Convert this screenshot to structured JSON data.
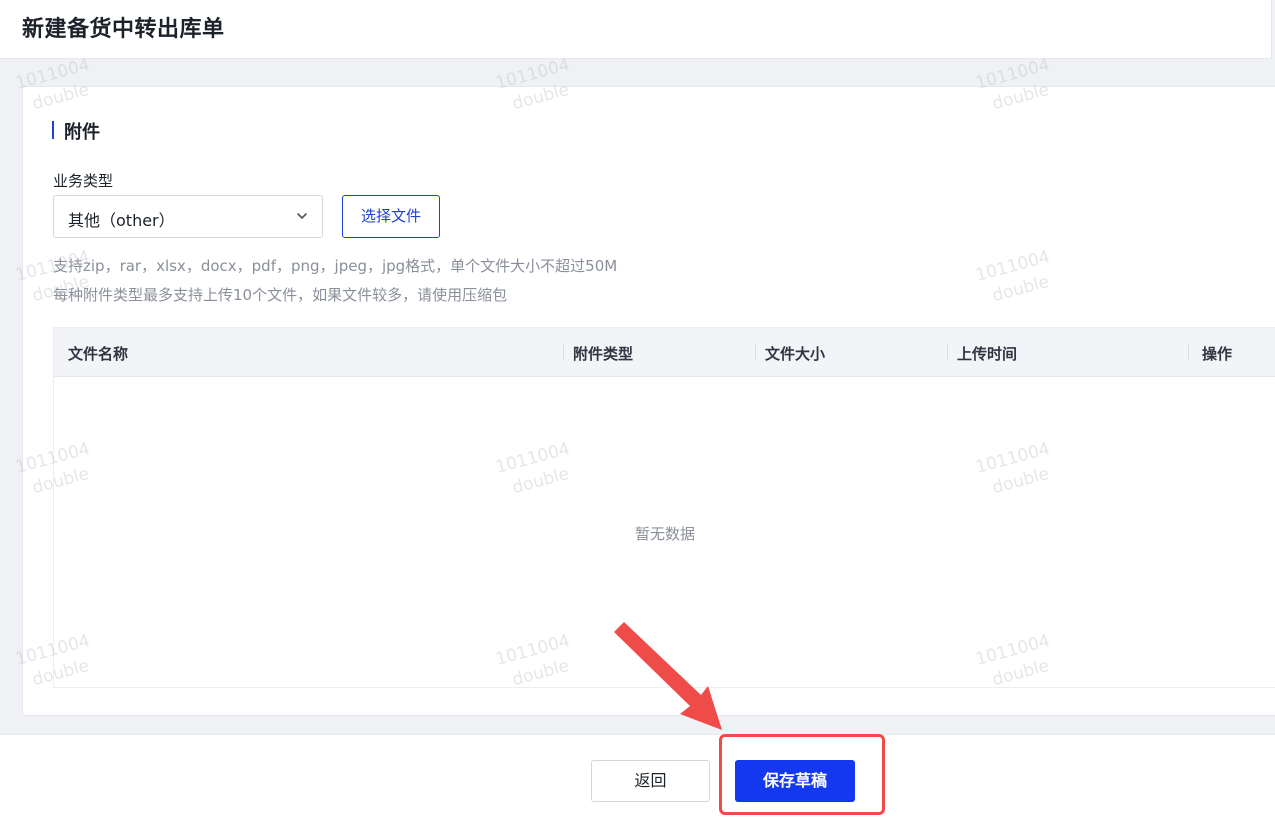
{
  "header": {
    "title": "新建备货中转出库单"
  },
  "attachments": {
    "section_title": "附件",
    "business_type_label": "业务类型",
    "business_type_value": "其他（other）",
    "choose_file_label": "选择文件",
    "hint_line1": "支持zip，rar，xlsx，docx，pdf，png，jpeg，jpg格式，单个文件大小不超过50M",
    "hint_line2": "每种附件类型最多支持上传10个文件，如果文件较多，请使用压缩包",
    "table": {
      "columns": [
        "文件名称",
        "附件类型",
        "文件大小",
        "上传时间",
        "操作"
      ],
      "empty_text": "暂无数据"
    }
  },
  "footer": {
    "back_label": "返回",
    "save_draft_label": "保存草稿"
  },
  "watermark": {
    "line1": "1011004",
    "line2": "double"
  },
  "colors": {
    "primary": "#1437f0",
    "annotation": "#ef4b48"
  },
  "icons": {
    "select": "chevron-down-icon",
    "annotation": "arrow-icon"
  }
}
